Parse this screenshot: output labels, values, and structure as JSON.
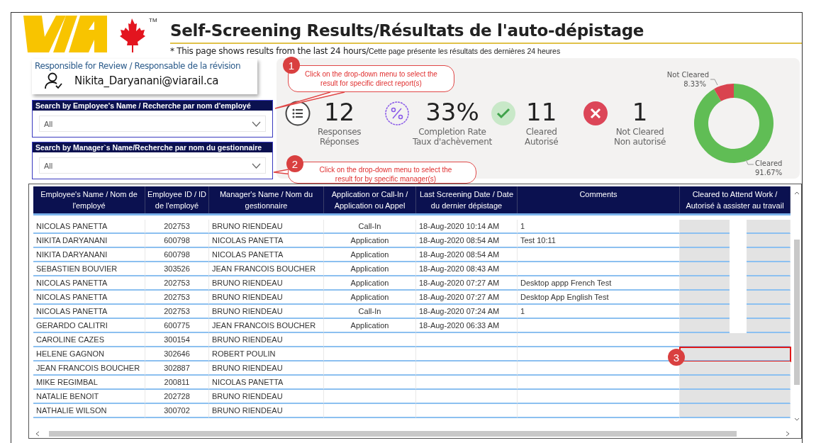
{
  "header": {
    "logo_mark": "TM",
    "title": "Self-Screening Results/Résultats de l'auto-dépistage",
    "note_en": "* This page shows results from the last 24 hours/",
    "note_fr": "Cette page présente les résultats des dernières 24 heures"
  },
  "reviewer": {
    "label": "Responsible for Review / Responsable de la révision",
    "email": "Nikita_Daryanani@viarail.ca"
  },
  "filters": [
    {
      "label": "Search by Employee's Name / Recherche par nom d'employé",
      "value": "All"
    },
    {
      "label": "Search by Manager`s Name/Recherche par nom du gestionnaire",
      "value": "All"
    }
  ],
  "kpis": [
    {
      "kind": "responses",
      "value": "12",
      "labels": [
        "Responses",
        "Réponses"
      ]
    },
    {
      "kind": "completion",
      "value": "33%",
      "labels": [
        "Completion Rate",
        "Taux d'achèvement"
      ]
    },
    {
      "kind": "cleared",
      "value": "11",
      "labels": [
        "Cleared",
        "Autorisé"
      ]
    },
    {
      "kind": "not_cleared",
      "value": "1",
      "labels": [
        "Not Cleared",
        "Non autorisé"
      ]
    }
  ],
  "donut": {
    "chart_data": {
      "type": "donut",
      "categories": [
        "Cleared",
        "Not Cleared"
      ],
      "values": [
        91.67,
        8.33
      ],
      "value_labels": [
        "91.67%",
        "8.33%"
      ]
    }
  },
  "callouts": [
    {
      "number": "1",
      "text": "Click on the drop-down menu to select the result for specific direct report(s)"
    },
    {
      "number": "2",
      "text": "Click on the drop-down menu to select the result for by specific manager(s)"
    },
    {
      "number": "3"
    }
  ],
  "table": {
    "columns": [
      "Employee's Name / Nom de l'employé",
      "Employee ID / ID de l'employé",
      "Manager's Name / Nom du gestionnaire",
      "Application or Call-In / Application ou Appel",
      "Last Screening Date / Date du dernier dépistage",
      "Comments",
      "Cleared to Attend Work / Autorisé à assister au travail"
    ],
    "rows": [
      {
        "cells": [
          "NICOLAS PANETTA",
          "202753",
          "BRUNO RIENDEAU",
          "Call-In",
          "18-Aug-2020 10:14 AM",
          "1"
        ],
        "redacted": true
      },
      {
        "cells": [
          "NIKITA DARYANANI",
          "600798",
          "NICOLAS PANETTA",
          "Application",
          "18-Aug-2020 08:54 AM",
          "Test 10:11"
        ],
        "redacted": true
      },
      {
        "cells": [
          "NIKITA DARYANANI",
          "600798",
          "NICOLAS PANETTA",
          "Application",
          "18-Aug-2020 08:54 AM",
          ""
        ],
        "redacted": true
      },
      {
        "cells": [
          "SEBASTIEN BOUVIER",
          "303526",
          "JEAN FRANCOIS BOUCHER",
          "Application",
          "18-Aug-2020 08:43 AM",
          ""
        ],
        "redacted": true
      },
      {
        "cells": [
          "NICOLAS PANETTA",
          "202753",
          "BRUNO RIENDEAU",
          "Application",
          "18-Aug-2020 07:27 AM",
          "Desktop appp French Test"
        ],
        "redacted": true
      },
      {
        "cells": [
          "NICOLAS PANETTA",
          "202753",
          "BRUNO RIENDEAU",
          "Application",
          "18-Aug-2020 07:27 AM",
          "Desktop App English Test"
        ],
        "redacted": true
      },
      {
        "cells": [
          "NICOLAS PANETTA",
          "202753",
          "BRUNO RIENDEAU",
          "Call-In",
          "18-Aug-2020 07:24 AM",
          "1"
        ],
        "redacted": true
      },
      {
        "cells": [
          "GERARDO CALITRI",
          "600775",
          "JEAN FRANCOIS BOUCHER",
          "Application",
          "18-Aug-2020 06:33 AM",
          ""
        ],
        "redacted": true
      },
      {
        "cells": [
          "CAROLINE CAZES",
          "300154",
          "BRUNO RIENDEAU",
          "",
          "",
          ""
        ],
        "redacted": false
      },
      {
        "cells": [
          "HELENE GAGNON",
          "302646",
          "ROBERT POULIN",
          "",
          "",
          ""
        ],
        "redacted": false,
        "highlighted": true
      },
      {
        "cells": [
          "JEAN FRANCOIS BOUCHER",
          "302887",
          "BRUNO RIENDEAU",
          "",
          "",
          ""
        ],
        "redacted": false
      },
      {
        "cells": [
          "MIKE REGIMBAL",
          "200811",
          "NICOLAS PANETTA",
          "",
          "",
          ""
        ],
        "redacted": false
      },
      {
        "cells": [
          "NATALIE BENOIT",
          "202728",
          "BRUNO RIENDEAU",
          "",
          "",
          ""
        ],
        "redacted": false
      },
      {
        "cells": [
          "NATHALIE WILSON",
          "300702",
          "BRUNO RIENDEAU",
          "",
          "",
          ""
        ],
        "redacted": false
      }
    ]
  }
}
